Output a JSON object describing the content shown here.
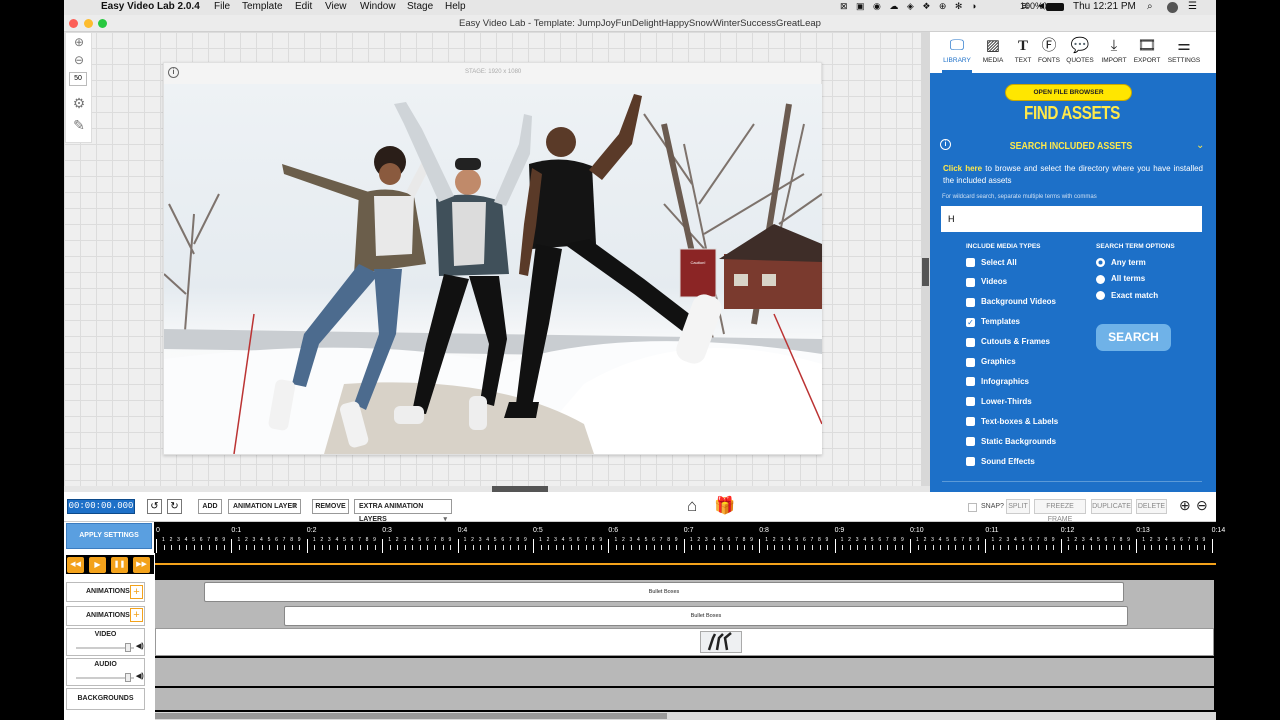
{
  "menubar": {
    "app_name": "Easy Video Lab 2.0.4",
    "items": [
      "File",
      "Template",
      "Edit",
      "View",
      "Window",
      "Stage",
      "Help"
    ],
    "battery": "100%",
    "clock": "Thu 12:21 PM"
  },
  "window": {
    "title": "Easy Video Lab - Template: JumpJoyFunDelightHappySnowWinterSuccessGreatLeap"
  },
  "tools": {
    "zoom_value": "50"
  },
  "stage": {
    "label": "STAGE: 1920 x 1080",
    "sign_text": "Caution! Cross Traffic Does NOT Stop for Pedestrians"
  },
  "panel": {
    "tabs": [
      "LIBRARY",
      "MEDIA",
      "TEXT",
      "FONTS",
      "QUOTES",
      "IMPORT",
      "EXPORT",
      "SETTINGS"
    ],
    "open_file_browser": "OPEN FILE BROWSER",
    "heading": "FIND ASSETS",
    "section_title": "SEARCH INCLUDED ASSETS",
    "click_here": "Click here",
    "browse_text": "to browse and select the directory where you have installed the included assets",
    "wildcard_hint": "For wildcard search, separate multiple terms with commas",
    "search_value": "H",
    "media_types_title": "INCLUDE MEDIA TYPES",
    "media_types": [
      {
        "label": "Select All",
        "checked": false
      },
      {
        "label": "Videos",
        "checked": false
      },
      {
        "label": "Background Videos",
        "checked": false
      },
      {
        "label": "Templates",
        "checked": true
      },
      {
        "label": "Cutouts & Frames",
        "checked": false
      },
      {
        "label": "Graphics",
        "checked": false
      },
      {
        "label": "Infographics",
        "checked": false
      },
      {
        "label": "Lower-Thirds",
        "checked": false
      },
      {
        "label": "Text-boxes & Labels",
        "checked": false
      },
      {
        "label": "Static Backgrounds",
        "checked": false
      },
      {
        "label": "Sound Effects",
        "checked": false
      }
    ],
    "term_options_title": "SEARCH TERM OPTIONS",
    "term_options": [
      {
        "label": "Any term",
        "selected": true
      },
      {
        "label": "All terms",
        "selected": false
      },
      {
        "label": "Exact match",
        "selected": false
      }
    ],
    "search_button": "SEARCH"
  },
  "timeline": {
    "timecode": "00:00:00.000",
    "add": "ADD",
    "layer_select": "ANIMATION LAYER",
    "remove": "REMOVE",
    "extra_layers": "EXTRA ANIMATION LAYERS",
    "snap": "SNAP?",
    "split": "SPLIT",
    "freeze": "FREEZE FRAME",
    "duplicate": "DUPLICATE",
    "delete": "DELETE",
    "apply_settings": "APPLY SETTINGS",
    "ruler_major": [
      "0",
      "0:1",
      "0:2",
      "0:3",
      "0:4",
      "0:5",
      "0:6",
      "0:7",
      "0:8",
      "0:9",
      "0:10",
      "0:11",
      "0:12",
      "0:13",
      "0:14"
    ],
    "ruler_minor": "1 2 3 4 5 6 7 8 9",
    "rows": {
      "animations1": "ANIMATIONS",
      "animations2": "ANIMATIONS",
      "video": "VIDEO",
      "audio": "AUDIO",
      "backgrounds": "BACKGROUNDS"
    },
    "clip1": "Bullet Boxes",
    "clip2": "Bullet Boxes"
  },
  "colors": {
    "panel_blue": "#1d70c8",
    "yellow": "#ffe600",
    "heading_yellow": "#ffe94a",
    "timecode_blue": "#1d70c8",
    "play_orange": "#f3a21b"
  }
}
